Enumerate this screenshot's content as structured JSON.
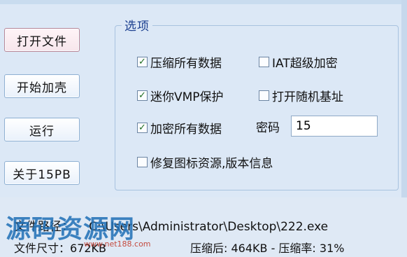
{
  "buttons": {
    "open_file": "打开文件",
    "start_pack": "开始加壳",
    "run": "运行",
    "about": "关于15PB"
  },
  "options": {
    "title": "选项",
    "compress_all": {
      "label": "压缩所有数据",
      "checked": true,
      "mark": "✓"
    },
    "iat_encrypt": {
      "label": "IAT超级加密",
      "checked": false,
      "mark": ""
    },
    "mini_vmp": {
      "label": "迷你VMP保护",
      "checked": true,
      "mark": "✓"
    },
    "random_base": {
      "label": "打开随机基址",
      "checked": false,
      "mark": ""
    },
    "encrypt_all": {
      "label": "加密所有数据",
      "checked": true,
      "mark": "✓"
    },
    "fix_icon": {
      "label": "修复图标资源,版本信息",
      "checked": false,
      "mark": ""
    },
    "password_label": "密码",
    "password_value": "15"
  },
  "info": {
    "path_label": "文件路径：",
    "path_value": "C:\\Users\\Administrator\\Desktop\\222.exe",
    "size_label": "文件尺寸：",
    "size_value": "672KB",
    "result": "压缩后: 464KB - 压缩率: 31%"
  },
  "watermark": {
    "text": "源码资源网",
    "url": "www.net188.com"
  }
}
